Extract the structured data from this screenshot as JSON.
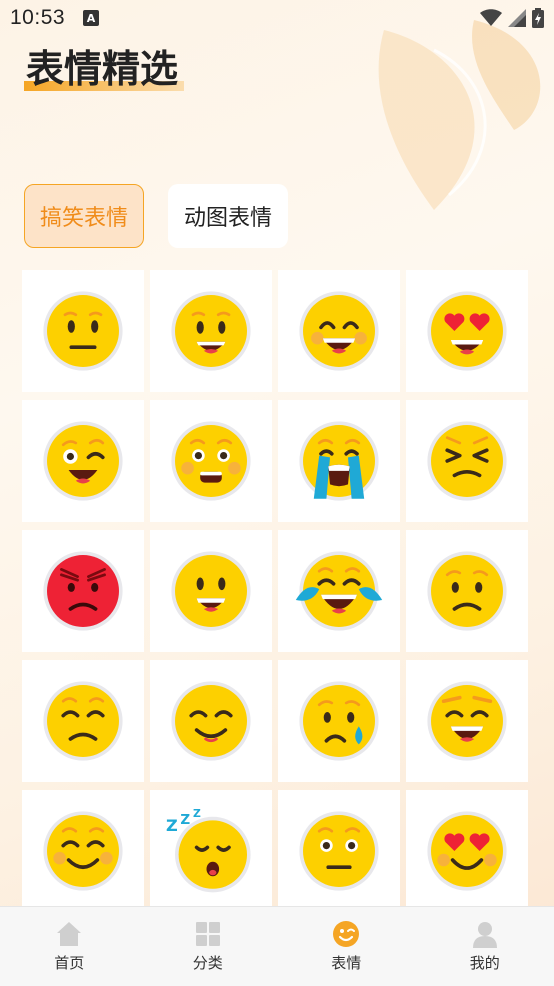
{
  "status_bar": {
    "time": "10:53",
    "notification_icon": "A"
  },
  "page_title": "表情精选",
  "tabs": [
    {
      "label": "搞笑表情",
      "active": true
    },
    {
      "label": "动图表情",
      "active": false
    }
  ],
  "emojis": [
    {
      "name": "neutral-face"
    },
    {
      "name": "happy-face"
    },
    {
      "name": "grinning-smile-face"
    },
    {
      "name": "heart-eyes-face"
    },
    {
      "name": "winking-face"
    },
    {
      "name": "surprised-blush-face"
    },
    {
      "name": "crying-loudly-face"
    },
    {
      "name": "squinting-frustrated-face"
    },
    {
      "name": "angry-red-face"
    },
    {
      "name": "smiling-open-mouth-face"
    },
    {
      "name": "tears-of-joy-face"
    },
    {
      "name": "worried-face"
    },
    {
      "name": "sad-closed-eyes-face"
    },
    {
      "name": "content-smile-face"
    },
    {
      "name": "sad-tear-face"
    },
    {
      "name": "beaming-face"
    },
    {
      "name": "blushing-smile-face"
    },
    {
      "name": "sleeping-face"
    },
    {
      "name": "expressionless-face"
    },
    {
      "name": "heart-eyes-smile-face"
    }
  ],
  "bottom_nav": [
    {
      "label": "首页",
      "icon": "home-icon",
      "active": false
    },
    {
      "label": "分类",
      "icon": "grid-icon",
      "active": false
    },
    {
      "label": "表情",
      "icon": "emoji-icon",
      "active": true
    },
    {
      "label": "我的",
      "icon": "person-icon",
      "active": false
    }
  ],
  "colors": {
    "accent": "#f5a524",
    "emoji_yellow": "#fdd000",
    "angry_red": "#ee2235"
  }
}
